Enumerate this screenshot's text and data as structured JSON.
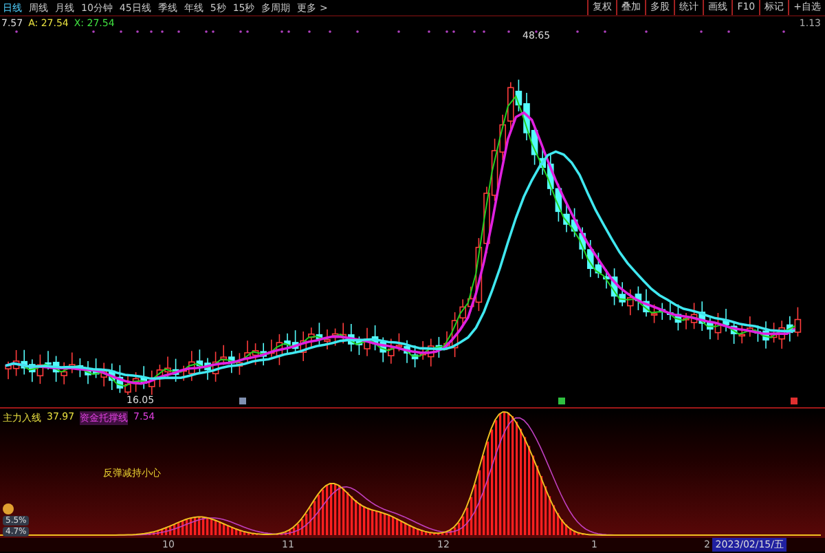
{
  "toolbar": {
    "periods": [
      {
        "label": "日线",
        "selected": true
      },
      {
        "label": "周线",
        "selected": false
      },
      {
        "label": "月线",
        "selected": false
      },
      {
        "label": "10分钟",
        "selected": false
      },
      {
        "label": "45日线",
        "selected": false
      },
      {
        "label": "季线",
        "selected": false
      },
      {
        "label": "年线",
        "selected": false
      },
      {
        "label": "5秒",
        "selected": false
      },
      {
        "label": "15秒",
        "selected": false
      },
      {
        "label": "多周期",
        "selected": false
      },
      {
        "label": "更多 >",
        "selected": false
      }
    ],
    "tools": [
      "复权",
      "叠加",
      "多股",
      "统计",
      "画线",
      "F10",
      "标记",
      "+自选"
    ]
  },
  "info": {
    "close": "7.57",
    "a": "A: 27.54",
    "x": "X: 27.54"
  },
  "main_chart": {
    "high_label": "48.65",
    "low_label": "16.05",
    "corner": "1.13"
  },
  "indicator": {
    "name": "主力入线",
    "value": "37.97",
    "name2": "资金托撑线",
    "value2": "7.54",
    "note": "反弹减持小心",
    "badges": [
      "5.5%",
      "4.7%"
    ]
  },
  "x_axis": [
    "10",
    "11",
    "12",
    "1",
    "2"
  ],
  "date": "2023/02/15/五"
}
